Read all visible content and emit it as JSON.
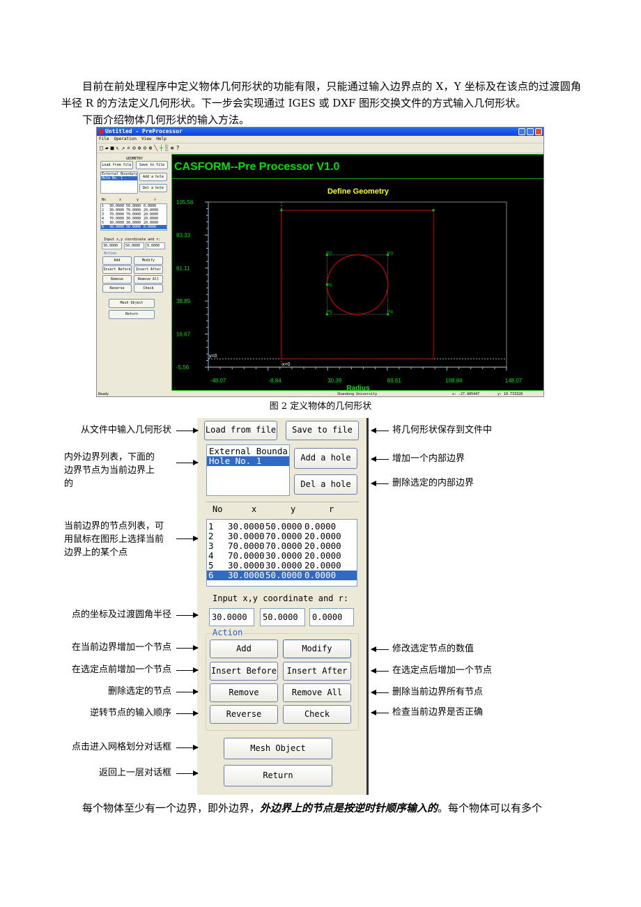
{
  "text": {
    "para1": "目前在前处理程序中定义物体几何形状的功能有限，只能通过输入边界点的 X，Y 坐标及在该点的过渡圆角半径 R 的方法定义几何形状。下一步会实现通过 IGES 或 DXF 图形交换文件的方式输入几何形状。",
    "para2": "下面介绍物体几何形状的输入方法。",
    "caption": "图 2  定义物体的几何形状",
    "final_a": "每个物体至少有一个边界，即外边界，",
    "final_b": "外边界上的节点是按逆时针顺序输入的",
    "final_c": "。每个物体可以有多个"
  },
  "window": {
    "title": "Untitled - PreProcessor",
    "menu": [
      "File",
      "Operation",
      "View",
      "Help"
    ],
    "toolbar_icons": [
      "new-icon",
      "open-icon",
      "save-icon",
      "pointer-icon",
      "pan-icon",
      "zoom-window-icon",
      "zoom-fit-icon",
      "zoom-in-icon",
      "zoom-out-icon",
      "zoom-all-icon",
      "line-icon",
      "axes-icon",
      "grid-icon",
      "list-icon",
      "help-icon"
    ],
    "status": {
      "left": "Ready",
      "center": "Shandong University",
      "x": "x: -27.985447",
      "y": "y: 10.733328"
    }
  },
  "panel": {
    "group": "GEOMETRY",
    "load": "Load from file",
    "save": "Save to file",
    "boundaries": [
      "External Boundary",
      "Hole No. 1"
    ],
    "selected_boundary": 1,
    "add_hole": "Add a hole",
    "del_hole": "Del a hole",
    "headers": [
      "No",
      "x",
      "y",
      "r"
    ],
    "nodes": [
      [
        "1",
        "30.0000",
        "50.0000",
        "0.0000"
      ],
      [
        "2",
        "30.0000",
        "70.0000",
        "20.0000"
      ],
      [
        "3",
        "70.0000",
        "70.0000",
        "20.0000"
      ],
      [
        "4",
        "70.0000",
        "30.0000",
        "20.0000"
      ],
      [
        "5",
        "30.0000",
        "30.0000",
        "20.0000"
      ],
      [
        "6",
        "30.0000",
        "50.0000",
        "0.0000"
      ]
    ],
    "selected_node": 5,
    "input_label": "Input x,y coordinate and r:",
    "inputs": [
      "30.0000",
      "50.0000",
      "0.0000"
    ],
    "action": "Action",
    "add": "Add",
    "modify": "Modify",
    "insert_before": "Insert Before",
    "insert_after": "Insert After",
    "remove": "Remove",
    "remove_all": "Remove All",
    "reverse": "Reverse",
    "check": "Check",
    "mesh": "Mesh Object",
    "return": "Return"
  },
  "canvas": {
    "header": "CASFORM--Pre Processor V1.0",
    "colors": {
      "header": "#00ff00",
      "title": "#ffff00",
      "boundary": "#cc0000"
    }
  },
  "chart_data": {
    "type": "scatter",
    "title": "Define Geometry",
    "xlabel": "Radius",
    "ylabel": "",
    "xlim": [
      -48.07,
      148.07
    ],
    "ylim": [
      -5.56,
      105.56
    ],
    "xticks": [
      "-48.07",
      "-8.84",
      "30.39",
      "69.61",
      "108.84",
      "148.07"
    ],
    "yticks": [
      "105.56",
      "83.33",
      "61.11",
      "38.89",
      "16.67",
      "-5.56"
    ],
    "axis_labels": {
      "x0": "x=0",
      "y0": "y=0"
    },
    "outer_boundary": [
      [
        0,
        0
      ],
      [
        0,
        100
      ],
      [
        100,
        100
      ],
      [
        100,
        0
      ]
    ],
    "hole_points": [
      {
        "label": "P2",
        "x": 30,
        "y": 70
      },
      {
        "label": "P3",
        "x": 70,
        "y": 70
      },
      {
        "label": "P4",
        "x": 70,
        "y": 30
      },
      {
        "label": "P5",
        "x": 30,
        "y": 30
      },
      {
        "label": "P6",
        "x": 30,
        "y": 50
      }
    ],
    "circle": {
      "cx": 50,
      "cy": 50,
      "r": 20
    }
  },
  "annotations": {
    "left": [
      "从文件中输入几何形状",
      "内外边界列表，下面的\n边界节点为当前边界上\n的",
      "当前边界的节点列表，可\n用鼠标在图形上选择当前\n边界上的某个点",
      "点的坐标及过渡圆角半径",
      "在当前边界增加一个节点",
      "在选定点前增加一个节点",
      "删除选定的节点",
      "逆转节点的输入顺序",
      "点击进入网格划分对话框",
      "返回上一层对话框"
    ],
    "right": [
      "将几何形状保存到文件中",
      "增加一个内部边界",
      "删除选定的内部边界",
      "修改选定节点的数值",
      "在选定点后增加一个节点",
      "删除当前边界所有节点",
      "检查当前边界是否正确"
    ]
  }
}
